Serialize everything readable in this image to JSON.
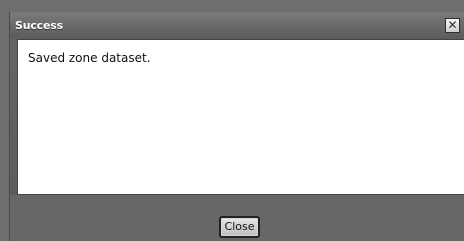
{
  "dialog": {
    "title": "Success",
    "close_icon_glyph": "✕",
    "message": "Saved zone dataset.",
    "close_button_label": "Close"
  },
  "colors": {
    "titlebar": "#6f6f6f",
    "content_background": "#ffffff",
    "footer_background": "#676767"
  }
}
